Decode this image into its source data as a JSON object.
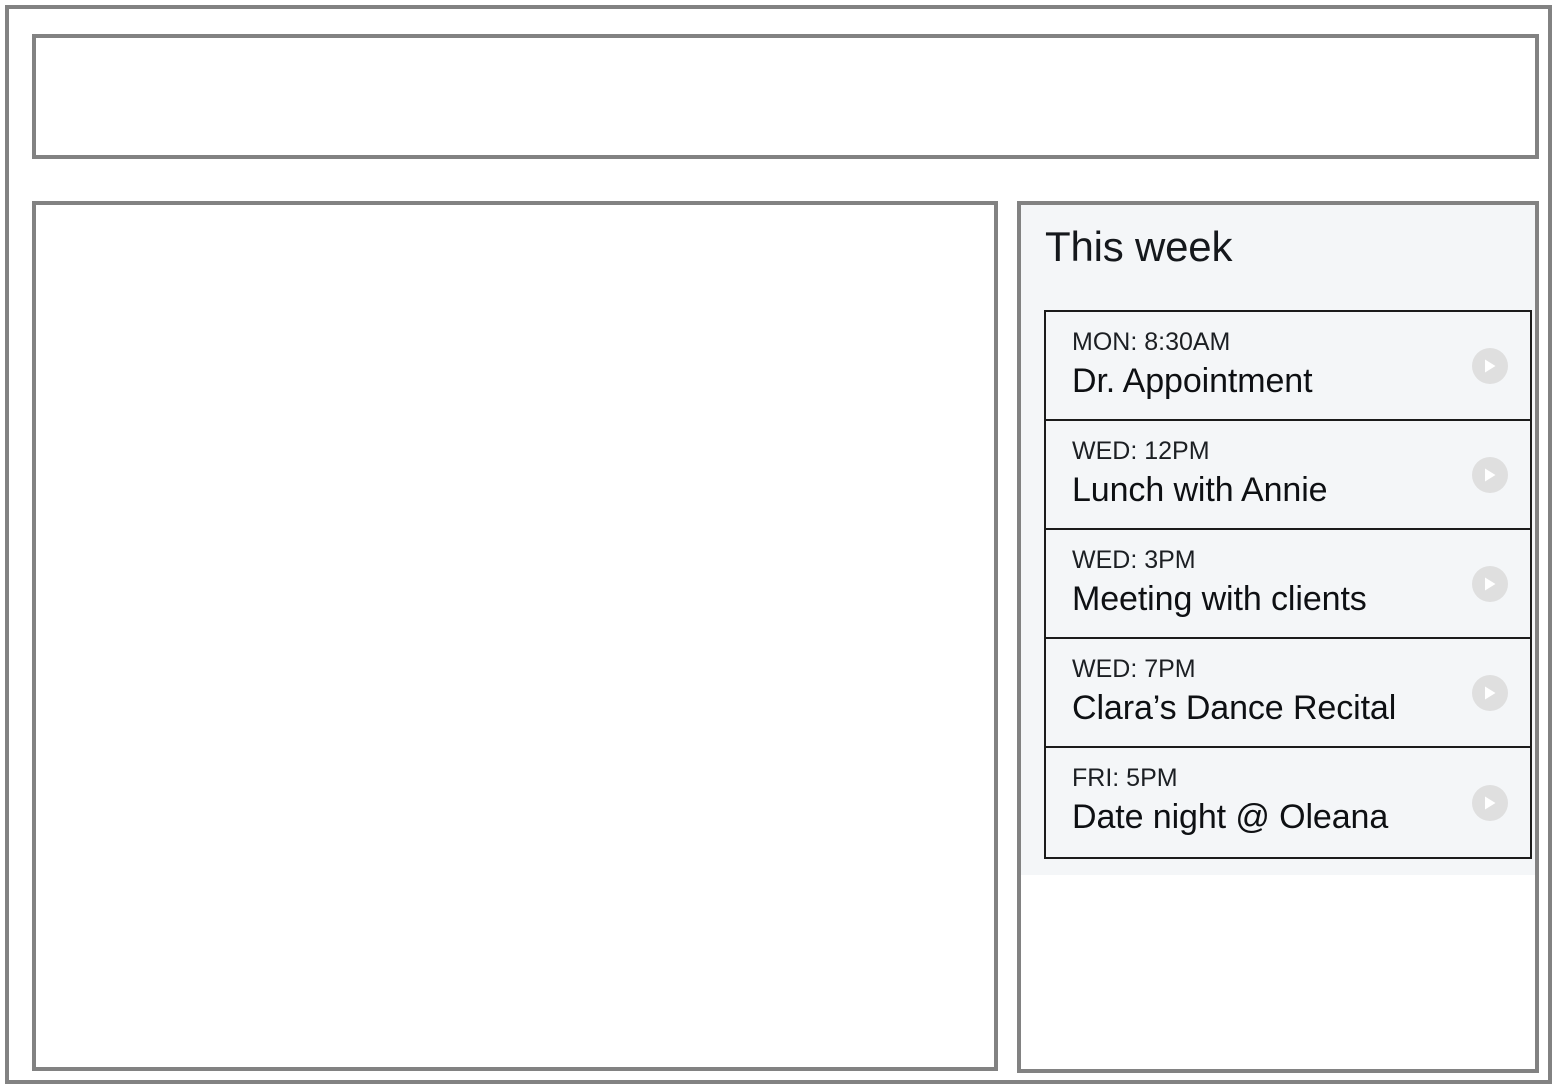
{
  "frame": {
    "outer_border_color": "#828282",
    "panel_border_color": "#828282"
  },
  "top_panel": {
    "content": ""
  },
  "content_panel": {
    "content": ""
  },
  "sidebar": {
    "title": "This week",
    "background_color": "#f4f6f8",
    "card_border_color": "#1b1b1b",
    "action_icon": "play-icon",
    "action_icon_bg": "#dfdfdf",
    "events": [
      {
        "time": "MON: 8:30AM",
        "title": "Dr. Appointment",
        "action_icon": "play-icon"
      },
      {
        "time": "WED: 12PM",
        "title": "Lunch with Annie",
        "action_icon": "play-icon"
      },
      {
        "time": "WED: 3PM",
        "title": "Meeting with clients",
        "action_icon": "play-icon"
      },
      {
        "time": "WED: 7PM",
        "title": "Clara’s Dance Recital",
        "action_icon": "play-icon"
      },
      {
        "time": "FRI: 5PM",
        "title": "Date night @ Oleana",
        "action_icon": "play-icon"
      }
    ]
  }
}
